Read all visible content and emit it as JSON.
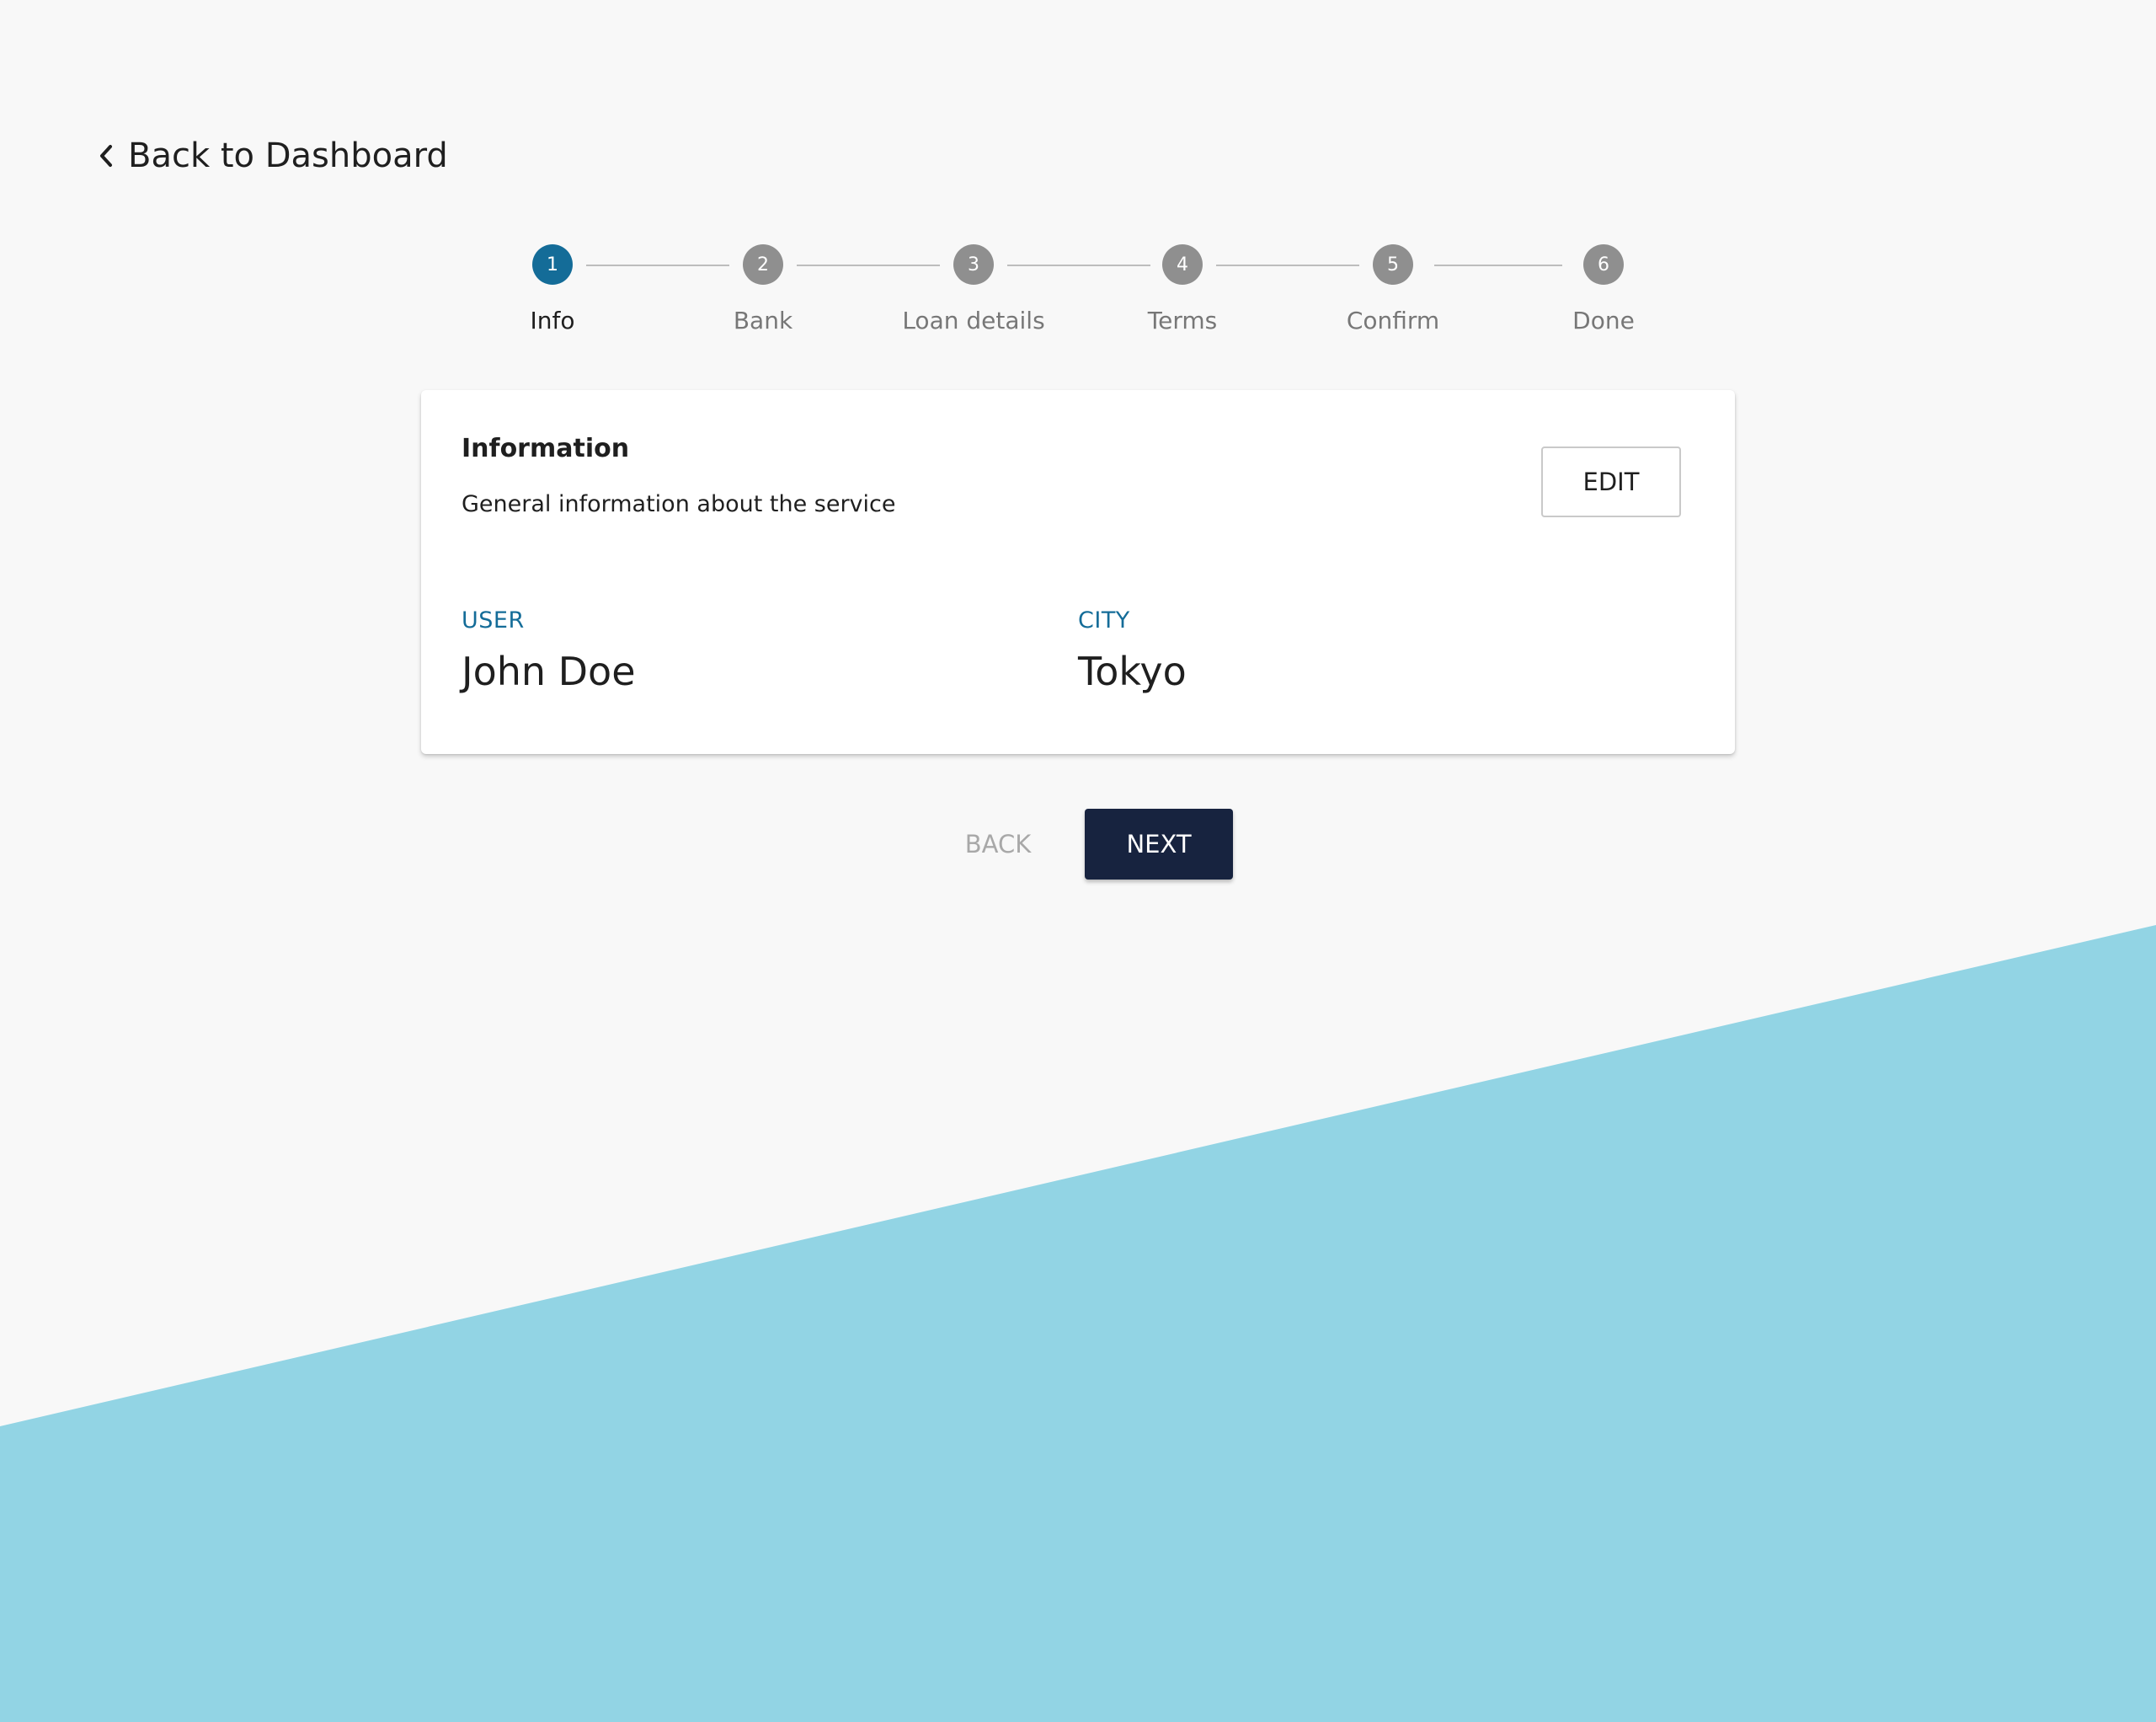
{
  "colors": {
    "page_background": "#f8f8f8",
    "accent_blue": "#146c98",
    "diagonal_band": "#92d4e4",
    "next_button": "#17233f",
    "inactive_step": "#8f8f8f"
  },
  "nav": {
    "back_to_dashboard_label": "Back to Dashboard",
    "back_icon": "chevron-left-icon"
  },
  "stepper": {
    "active_step": 1,
    "steps": [
      {
        "number": "1",
        "label": "Info"
      },
      {
        "number": "2",
        "label": "Bank"
      },
      {
        "number": "3",
        "label": "Loan details"
      },
      {
        "number": "4",
        "label": "Terms"
      },
      {
        "number": "5",
        "label": "Confirm"
      },
      {
        "number": "6",
        "label": "Done"
      }
    ]
  },
  "card": {
    "title": "Information",
    "subtitle": "General information about the service",
    "edit_label": "EDIT",
    "fields": [
      {
        "label": "USER",
        "value": "John Doe"
      },
      {
        "label": "CITY",
        "value": "Tokyo"
      }
    ]
  },
  "actions": {
    "back_label": "BACK",
    "next_label": "NEXT"
  }
}
